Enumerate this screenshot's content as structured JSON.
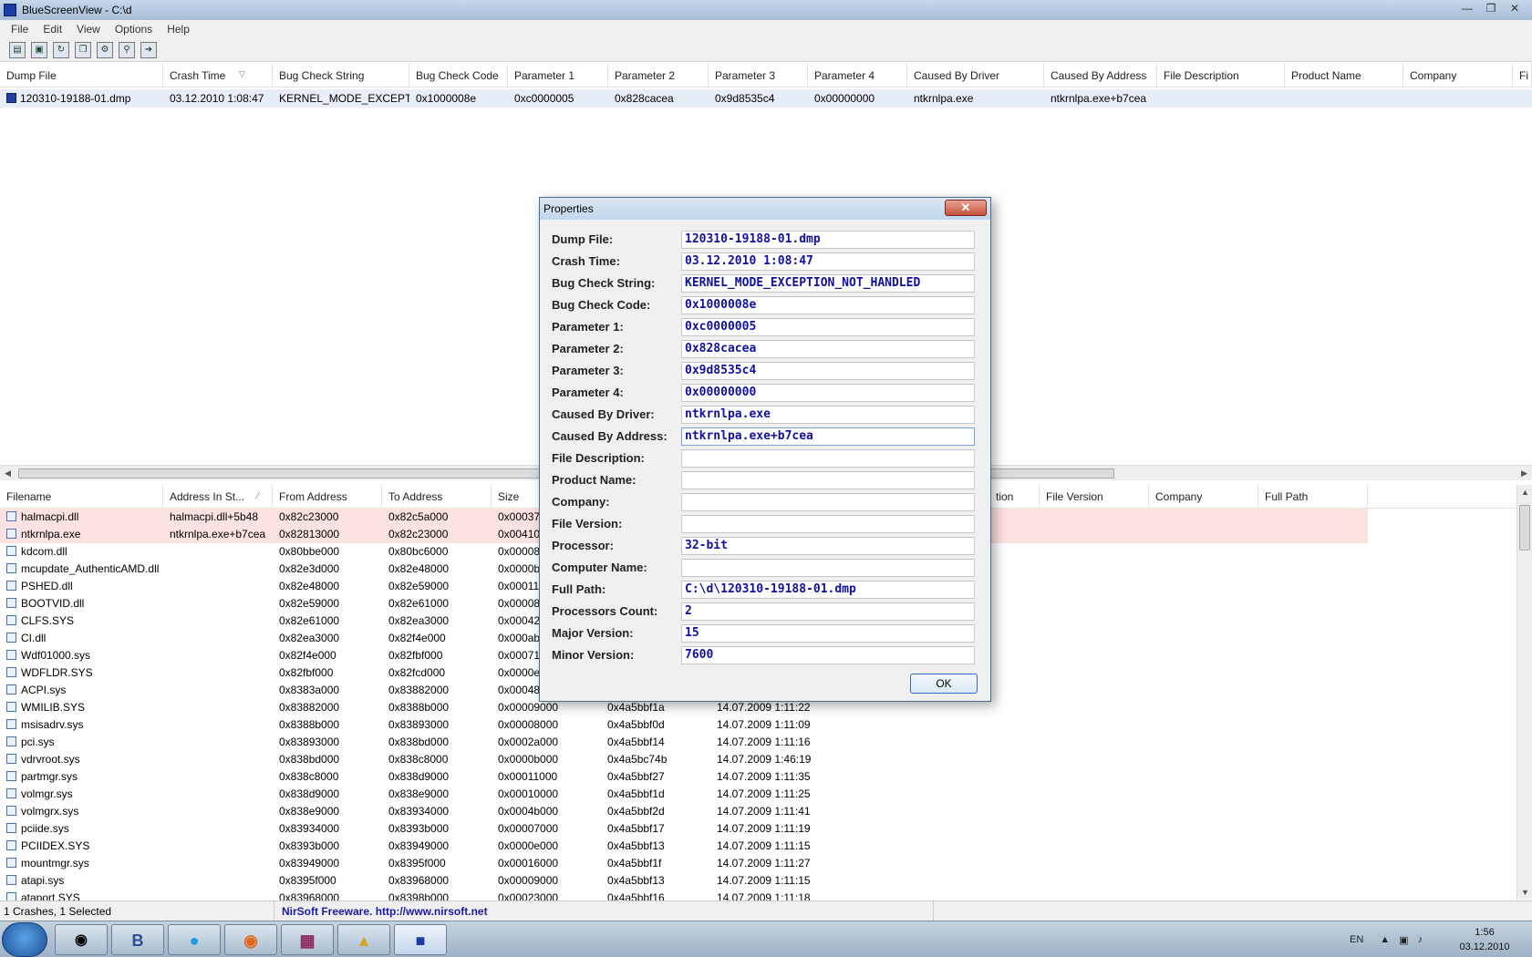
{
  "window": {
    "title": "BlueScreenView  -  C:\\d"
  },
  "menu": [
    "File",
    "Edit",
    "View",
    "Options",
    "Help"
  ],
  "toolbar_icons": [
    "properties-icon",
    "save-icon",
    "refresh-icon",
    "copy-icon",
    "options-icon",
    "find-icon",
    "exit-icon"
  ],
  "upper": {
    "columns": [
      "Dump File",
      "Crash Time",
      "Bug Check String",
      "Bug Check Code",
      "Parameter 1",
      "Parameter 2",
      "Parameter 3",
      "Parameter 4",
      "Caused By Driver",
      "Caused By Address",
      "File Description",
      "Product Name",
      "Company",
      "Fi"
    ],
    "sort_column": "Crash Time",
    "rows": [
      [
        "120310-19188-01.dmp",
        "03.12.2010 1:08:47",
        "KERNEL_MODE_EXCEPTI...",
        "0x1000008e",
        "0xc0000005",
        "0x828cacea",
        "0x9d8535c4",
        "0x00000000",
        "ntkrnlpa.exe",
        "ntkrnlpa.exe+b7cea",
        "",
        "",
        "",
        ""
      ]
    ]
  },
  "lower": {
    "columns": [
      "Filename",
      "Address In St...",
      "From Address",
      "To Address",
      "Size",
      "",
      "",
      "",
      "",
      "tion",
      "File Version",
      "Company",
      "Full Path"
    ],
    "rows": [
      {
        "f": "halmacpi.dll",
        "a": "halmacpi.dll+5b48",
        "from": "0x82c23000",
        "to": "0x82c5a000",
        "size": "0x000370",
        "ts": "",
        "date": "",
        "hl": true
      },
      {
        "f": "ntkrnlpa.exe",
        "a": "ntkrnlpa.exe+b7cea",
        "from": "0x82813000",
        "to": "0x82c23000",
        "size": "0x004100",
        "ts": "",
        "date": "",
        "hl": true
      },
      {
        "f": "kdcom.dll",
        "a": "",
        "from": "0x80bbe000",
        "to": "0x80bc6000",
        "size": "0x000080",
        "ts": "",
        "date": "",
        "hl": false
      },
      {
        "f": "mcupdate_AuthenticAMD.dll",
        "a": "",
        "from": "0x82e3d000",
        "to": "0x82e48000",
        "size": "0x0000b0",
        "ts": "",
        "date": "",
        "hl": false
      },
      {
        "f": "PSHED.dll",
        "a": "",
        "from": "0x82e48000",
        "to": "0x82e59000",
        "size": "0x000110",
        "ts": "",
        "date": "",
        "hl": false
      },
      {
        "f": "BOOTVID.dll",
        "a": "",
        "from": "0x82e59000",
        "to": "0x82e61000",
        "size": "0x000080",
        "ts": "",
        "date": "",
        "hl": false
      },
      {
        "f": "CLFS.SYS",
        "a": "",
        "from": "0x82e61000",
        "to": "0x82ea3000",
        "size": "0x000420",
        "ts": "",
        "date": "",
        "hl": false
      },
      {
        "f": "CI.dll",
        "a": "",
        "from": "0x82ea3000",
        "to": "0x82f4e000",
        "size": "0x000ab0",
        "ts": "",
        "date": "",
        "hl": false
      },
      {
        "f": "Wdf01000.sys",
        "a": "",
        "from": "0x82f4e000",
        "to": "0x82fbf000",
        "size": "0x000710",
        "ts": "",
        "date": "",
        "hl": false
      },
      {
        "f": "WDFLDR.SYS",
        "a": "",
        "from": "0x82fbf000",
        "to": "0x82fcd000",
        "size": "0x0000e0",
        "ts": "",
        "date": "",
        "hl": false
      },
      {
        "f": "ACPI.sys",
        "a": "",
        "from": "0x8383a000",
        "to": "0x83882000",
        "size": "0x000480",
        "ts": "",
        "date": "",
        "hl": false
      },
      {
        "f": "WMILIB.SYS",
        "a": "",
        "from": "0x83882000",
        "to": "0x8388b000",
        "size": "0x00009000",
        "ts": "0x4a5bbf1a",
        "date": "14.07.2009 1:11:22",
        "hl": false
      },
      {
        "f": "msisadrv.sys",
        "a": "",
        "from": "0x8388b000",
        "to": "0x83893000",
        "size": "0x00008000",
        "ts": "0x4a5bbf0d",
        "date": "14.07.2009 1:11:09",
        "hl": false
      },
      {
        "f": "pci.sys",
        "a": "",
        "from": "0x83893000",
        "to": "0x838bd000",
        "size": "0x0002a000",
        "ts": "0x4a5bbf14",
        "date": "14.07.2009 1:11:16",
        "hl": false
      },
      {
        "f": "vdrvroot.sys",
        "a": "",
        "from": "0x838bd000",
        "to": "0x838c8000",
        "size": "0x0000b000",
        "ts": "0x4a5bc74b",
        "date": "14.07.2009 1:46:19",
        "hl": false
      },
      {
        "f": "partmgr.sys",
        "a": "",
        "from": "0x838c8000",
        "to": "0x838d9000",
        "size": "0x00011000",
        "ts": "0x4a5bbf27",
        "date": "14.07.2009 1:11:35",
        "hl": false
      },
      {
        "f": "volmgr.sys",
        "a": "",
        "from": "0x838d9000",
        "to": "0x838e9000",
        "size": "0x00010000",
        "ts": "0x4a5bbf1d",
        "date": "14.07.2009 1:11:25",
        "hl": false
      },
      {
        "f": "volmgrx.sys",
        "a": "",
        "from": "0x838e9000",
        "to": "0x83934000",
        "size": "0x0004b000",
        "ts": "0x4a5bbf2d",
        "date": "14.07.2009 1:11:41",
        "hl": false
      },
      {
        "f": "pciide.sys",
        "a": "",
        "from": "0x83934000",
        "to": "0x8393b000",
        "size": "0x00007000",
        "ts": "0x4a5bbf17",
        "date": "14.07.2009 1:11:19",
        "hl": false
      },
      {
        "f": "PCIIDEX.SYS",
        "a": "",
        "from": "0x8393b000",
        "to": "0x83949000",
        "size": "0x0000e000",
        "ts": "0x4a5bbf13",
        "date": "14.07.2009 1:11:15",
        "hl": false
      },
      {
        "f": "mountmgr.sys",
        "a": "",
        "from": "0x83949000",
        "to": "0x8395f000",
        "size": "0x00016000",
        "ts": "0x4a5bbf1f",
        "date": "14.07.2009 1:11:27",
        "hl": false
      },
      {
        "f": "atapi.sys",
        "a": "",
        "from": "0x8395f000",
        "to": "0x83968000",
        "size": "0x00009000",
        "ts": "0x4a5bbf13",
        "date": "14.07.2009 1:11:15",
        "hl": false
      },
      {
        "f": "ataport.SYS",
        "a": "",
        "from": "0x83968000",
        "to": "0x8398b000",
        "size": "0x00023000",
        "ts": "0x4a5bbf16",
        "date": "14.07.2009 1:11:18",
        "hl": false
      }
    ]
  },
  "dialog": {
    "title": "Properties",
    "close": "✕",
    "ok": "OK",
    "fields": [
      {
        "label": "Dump File:",
        "value": "120310-19188-01.dmp"
      },
      {
        "label": "Crash Time:",
        "value": "03.12.2010 1:08:47"
      },
      {
        "label": "Bug Check String:",
        "value": "KERNEL_MODE_EXCEPTION_NOT_HANDLED"
      },
      {
        "label": "Bug Check Code:",
        "value": "0x1000008e"
      },
      {
        "label": "Parameter 1:",
        "value": "0xc0000005"
      },
      {
        "label": "Parameter 2:",
        "value": "0x828cacea"
      },
      {
        "label": "Parameter 3:",
        "value": "0x9d8535c4"
      },
      {
        "label": "Parameter 4:",
        "value": "0x00000000"
      },
      {
        "label": "Caused By Driver:",
        "value": "ntkrnlpa.exe"
      },
      {
        "label": "Caused By Address:",
        "value": "ntkrnlpa.exe+b7cea",
        "focus": true
      },
      {
        "label": "File Description:",
        "value": ""
      },
      {
        "label": "Product Name:",
        "value": ""
      },
      {
        "label": "Company:",
        "value": ""
      },
      {
        "label": "File Version:",
        "value": ""
      },
      {
        "label": "Processor:",
        "value": "32-bit"
      },
      {
        "label": "Computer Name:",
        "value": ""
      },
      {
        "label": "Full Path:",
        "value": "C:\\d\\120310-19188-01.dmp"
      },
      {
        "label": "Processors Count:",
        "value": "2"
      },
      {
        "label": "Major Version:",
        "value": "15"
      },
      {
        "label": "Minor Version:",
        "value": "7600"
      }
    ]
  },
  "status": {
    "count": "1 Crashes, 1 Selected",
    "credit": "NirSoft Freeware.  http://www.nirsoft.net"
  },
  "taskbar": {
    "apps": [
      "B"
    ],
    "lang": "EN",
    "time": "1:56",
    "date": "03.12.2010"
  },
  "colors": {
    "highlight_row": "#fde2e2",
    "selected_row": "#e8eef7",
    "dialog_value": "#1010a0",
    "title_gradient": "#c9d8ea"
  }
}
